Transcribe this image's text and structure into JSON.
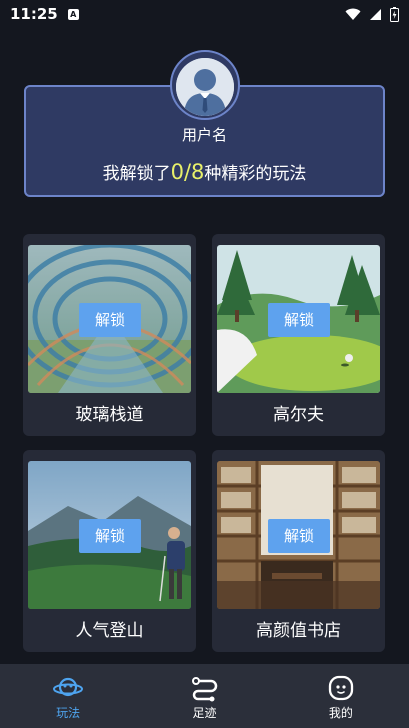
{
  "status_bar": {
    "time": "11:25",
    "app_icon_letter": "A"
  },
  "profile": {
    "username": "用户名",
    "unlock_prefix": "我解锁了",
    "unlock_count": "0/8",
    "unlock_suffix": "种精彩的玩法"
  },
  "cards": [
    {
      "label": "玻璃栈道",
      "button": "解锁"
    },
    {
      "label": "高尔夫",
      "button": "解锁"
    },
    {
      "label": "人气登山",
      "button": "解锁"
    },
    {
      "label": "高颜值书店",
      "button": "解锁"
    }
  ],
  "nav": {
    "items": [
      {
        "label": "玩法",
        "icon": "planet-icon",
        "active": true
      },
      {
        "label": "足迹",
        "icon": "route-icon",
        "active": false
      },
      {
        "label": "我的",
        "icon": "face-icon",
        "active": false
      }
    ]
  },
  "colors": {
    "background": "#14171f",
    "card_bg": "#262a37",
    "profile_bg": "#2f3a63",
    "profile_border": "#6d84c9",
    "accent_blue": "#5ea2ee",
    "count_yellow": "#e8f06a",
    "nav_active": "#4ea4ef"
  }
}
